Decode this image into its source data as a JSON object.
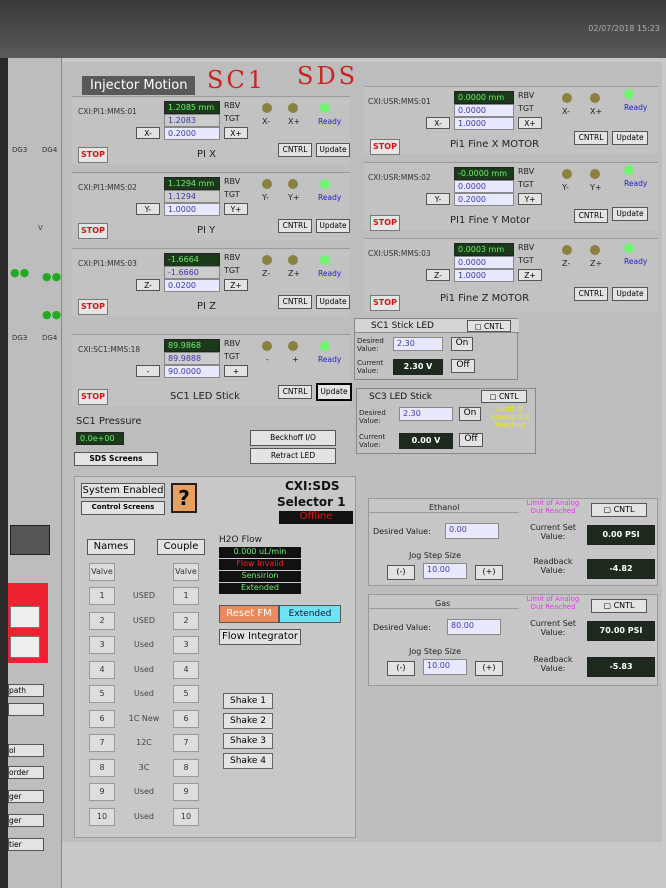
{
  "timestamp": "02/07/2018 15:23",
  "app": {
    "tab": "Injector Motion",
    "title_left": "SC1",
    "title_right": "SDS"
  },
  "motors": [
    {
      "pv": "CXI:PI1:MMS:01",
      "rbv": "1.2085 mm",
      "tgt": "1.2083",
      "step": "0.2000",
      "minus": "X-",
      "plus": "X+",
      "neg": "X-",
      "pos": "X+",
      "name": "PI X",
      "status": "Ready"
    },
    {
      "pv": "CXI:PI1:MMS:02",
      "rbv": "1.1294 mm",
      "tgt": "1.1294",
      "step": "1.0000",
      "minus": "Y-",
      "plus": "Y+",
      "neg": "Y-",
      "pos": "Y+",
      "name": "PI Y",
      "status": "Ready"
    },
    {
      "pv": "CXI:PI1:MMS:03",
      "rbv": "-1.6664 mm",
      "tgt": "-1.6660",
      "step": "0.0200",
      "minus": "Z-",
      "plus": "Z+",
      "neg": "Z-",
      "pos": "Z+",
      "name": "PI Z",
      "status": "Ready"
    },
    {
      "pv": "CXI:SC1:MMS:18",
      "rbv": "89.9868",
      "tgt": "89.9888",
      "step": "90.0000",
      "minus": "-",
      "plus": "+",
      "neg": "-",
      "pos": "+",
      "name": "SC1 LED Stick",
      "status": "Ready"
    },
    {
      "pv": "CXI:USR:MMS:01",
      "rbv": "0.0000 mm",
      "tgt": "0.0000",
      "step": "1.0000",
      "minus": "X-",
      "plus": "X+",
      "neg": "X-",
      "pos": "X+",
      "name": "Pi1 Fine X MOTOR",
      "status": "Ready"
    },
    {
      "pv": "CXI:USR:MMS:02",
      "rbv": "-0.0000 mm",
      "tgt": "0.0000",
      "step": "0.2000",
      "minus": "Y-",
      "plus": "Y+",
      "neg": "Y-",
      "pos": "Y+",
      "name": "PI1 Fine Y Motor",
      "status": "Ready"
    },
    {
      "pv": "CXI:USR:MMS:03",
      "rbv": "0.0003 mm",
      "tgt": "0.0000",
      "step": "1.0000",
      "minus": "Z-",
      "plus": "Z+",
      "neg": "Z-",
      "pos": "Z+",
      "name": "Pi1 Fine Z MOTOR",
      "status": "Ready"
    }
  ],
  "labels": {
    "rbv": "RBV",
    "tgt": "TGT",
    "stop": "STOP",
    "cntrl": "CNTRL",
    "update": "Update",
    "cntl": "CNTL",
    "on": "On",
    "off": "Off",
    "desired": "Desired Value:",
    "current": "Current Value:"
  },
  "sc1_led": {
    "title": "SC1 Stick LED",
    "desired": "2.30",
    "current": "2.30 V"
  },
  "sc3_led": {
    "title": "SC3 LED Stick",
    "desired": "2.30",
    "current": "0.00 V",
    "warning": "Limit of Analog Out Reached"
  },
  "pressure": {
    "label": "SC1 Pressure",
    "value": "0.0e+00",
    "sds_button": "SDS Screens"
  },
  "beckhoff": "Beckhoff I/O",
  "retract": "Retract LED",
  "selector": {
    "system_enabled": "System Enabled",
    "control_screens": "Control Screens",
    "question": "?",
    "name": "CXI:SDS",
    "subtitle": "Selector 1",
    "status": "Offline",
    "names_btn": "Names",
    "couple_btn": "Couple",
    "valve_hdr": "Valve",
    "couple_hdr": "Valve",
    "rows": [
      {
        "n": "1",
        "label": "USED"
      },
      {
        "n": "2",
        "label": "USED"
      },
      {
        "n": "3",
        "label": "Used"
      },
      {
        "n": "4",
        "label": "Used"
      },
      {
        "n": "5",
        "label": "Used"
      },
      {
        "n": "6",
        "label": "1C New"
      },
      {
        "n": "7",
        "label": "12C"
      },
      {
        "n": "8",
        "label": "3C"
      },
      {
        "n": "9",
        "label": "Used"
      },
      {
        "n": "10",
        "label": "Used"
      }
    ],
    "h2o_title": "H2O Flow",
    "flow": "0.000 uL/min",
    "flow_invalid": "Flow Invalid",
    "sensirion": "Sensirion",
    "extended": "Extended",
    "reset_fm": "Reset FM",
    "extended_btn": "Extended",
    "flow_integrator": "Flow Integrator",
    "shakes": [
      "Shake 1",
      "Shake 2",
      "Shake 3",
      "Shake 4"
    ]
  },
  "ethanol": {
    "title": "Ethanol",
    "desired_label": "Desired Value:",
    "desired": "0.00",
    "jog_label": "Jog Step Size",
    "jog": "10.00",
    "minus": "(-)",
    "plus": "(+)",
    "current_label": "Current Set Value:",
    "current": "0.00 PSI",
    "readback_label": "Readback Value:",
    "readback": "-4.82",
    "warning": "Limit of Analog Out Reached"
  },
  "gas": {
    "title": "Gas",
    "desired_label": "Desired Value:",
    "desired": "80.00",
    "jog_label": "Jog Step Size",
    "jog": "10.00",
    "minus": "(-)",
    "plus": "(+)",
    "current_label": "Current Set Value:",
    "current": "70.00 PSI",
    "readback_label": "Readback Value:",
    "readback": "-5.83",
    "warning": "Limit of Analog Out Reached"
  },
  "left_strip": {
    "dg3": "DG3",
    "dg4": "DG4",
    "dg3b": "DG3",
    "dg4b": "DG4",
    "v": "V",
    "items": [
      "path",
      "ol",
      "order",
      "ger",
      "ger",
      "tier"
    ]
  }
}
